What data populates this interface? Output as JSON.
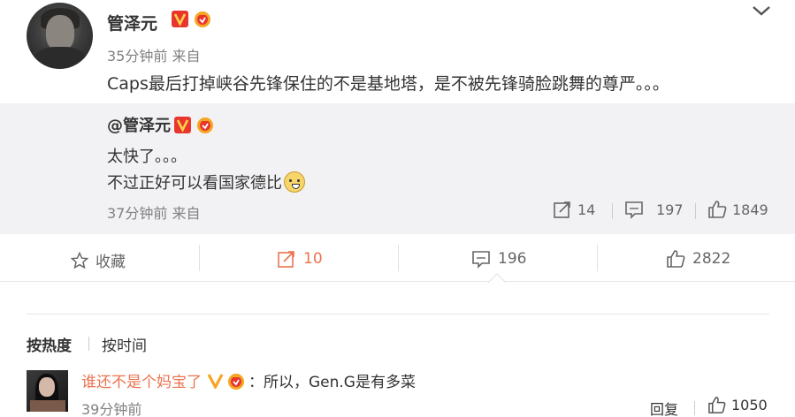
{
  "post": {
    "username": "管泽元",
    "time": "35分钟前 来自",
    "text": "Caps最后打掉峡谷先锋保住的不是基地塔，是不被先锋骑脸跳舞的尊严。。。"
  },
  "quoted": {
    "username": "@管泽元",
    "line1": "太快了。。。",
    "line2": "不过正好可以看国家德比",
    "time": "37分钟前 来自",
    "reposts": "14",
    "comments": "197",
    "likes": "1849"
  },
  "actions": {
    "favorite_label": "收藏",
    "repost_count": "10",
    "comment_count": "196",
    "like_count": "2822"
  },
  "sort": {
    "hot_label": "按热度",
    "time_label": "按时间"
  },
  "comment": {
    "username": "谁还不是个妈宝了",
    "text": "：所以，Gen.G是有多菜",
    "time": "39分钟前",
    "reply_label": "回复",
    "likes": "1050"
  },
  "colors": {
    "accent_orange": "#eb7350",
    "quote_bg": "#f2f2f5",
    "vip_red": "#e8352e",
    "gold": "#f5a623"
  },
  "icons": [
    "chevron-down-icon",
    "verified-v-icon",
    "vip-crown-icon",
    "repost-icon",
    "comment-icon",
    "like-icon",
    "star-icon",
    "doge-emoji-icon"
  ]
}
